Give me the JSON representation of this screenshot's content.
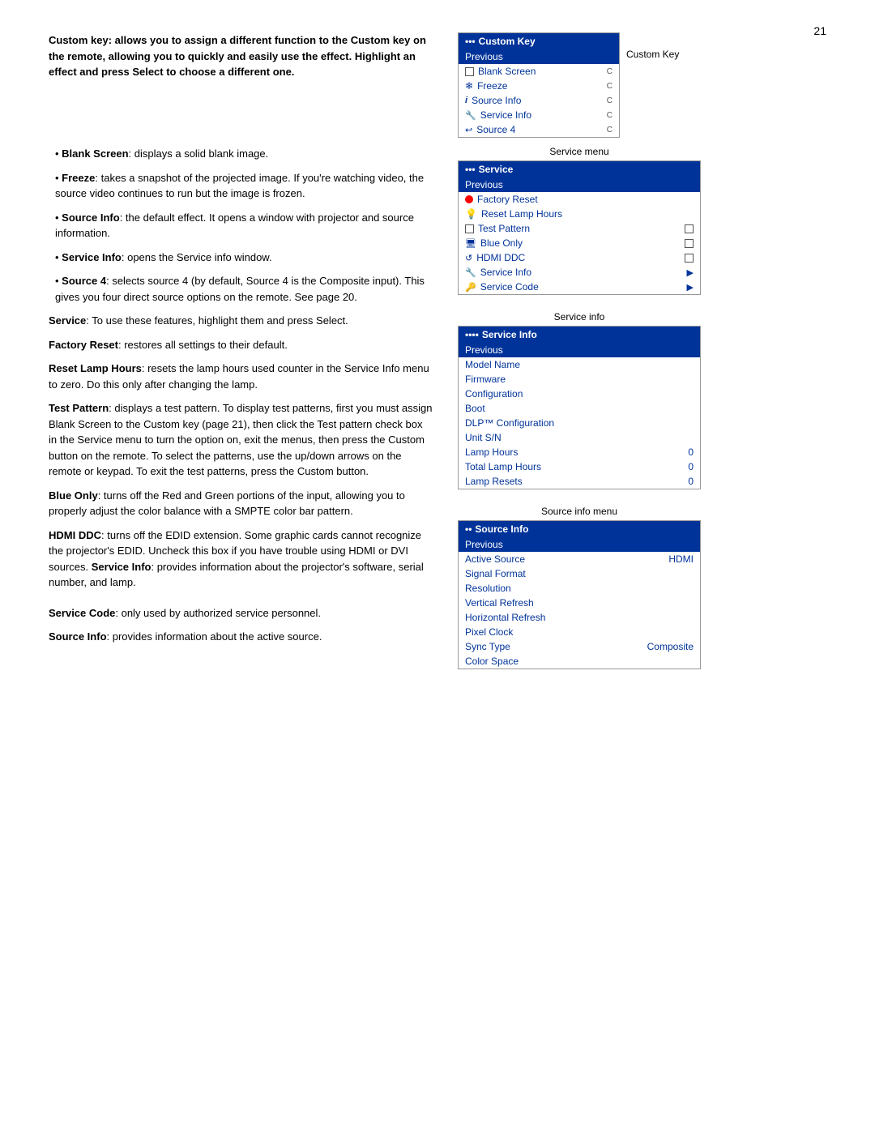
{
  "page": {
    "number": "21"
  },
  "left_content": {
    "intro": "Custom key: allows you to assign a different function to the Custom key on the remote, allowing you to quickly and easily use the effect. Highlight an effect and press Select to choose a different one.",
    "blank_screen_label": "Blank Screen",
    "blank_screen_text": ": displays a solid blank image.",
    "freeze_label": "Freeze",
    "freeze_text": ": takes a snapshot of the projected image. If you're watching video, the source video continues to run but the image is frozen.",
    "source_info_label": "Source Info",
    "source_info_text": ": the default effect. It opens a window with projector and source information.",
    "service_info_label": "Service Info",
    "service_info_text": ": opens the Service info window.",
    "source4_label": "Source 4",
    "source4_text": ": selects source 4 (by default, Source 4 is the Composite input). This gives you four direct source options on the remote. See page 20.",
    "service_intro_label": "Service",
    "service_intro_text": ": To use these features, highlight them and press Select.",
    "factory_reset_label": "Factory Reset",
    "factory_reset_text": ": restores all settings to their default.",
    "reset_lamp_label": "Reset Lamp Hours",
    "reset_lamp_text": ": resets the lamp hours used counter in the Service Info menu to zero. Do this only after changing the lamp.",
    "test_pattern_label": "Test Pattern",
    "test_pattern_text": ": displays a test pattern. To display test patterns, first you must assign Blank Screen to the Custom key (page 21), then click the Test pattern check box in the Service menu to turn the option on, exit the menus, then press the Custom button on the remote. To select the patterns, use the up/down arrows on the remote or keypad. To exit the test patterns, press the Custom button.",
    "blue_only_label": "Blue Only",
    "blue_only_text": ": turns off the Red and Green portions of the input, allowing you to properly adjust the color balance with a SMPTE color bar pattern.",
    "hdmi_ddc_label": "HDMI DDC",
    "hdmi_ddc_text": ": turns off the EDID extension. Some graphic cards cannot recognize the projector's EDID. Uncheck this box if you have trouble using HDMI or DVI sources.",
    "service_info2_label": "Service Info",
    "service_info2_text": ": provides information about the projector's software, serial number, and lamp.",
    "service_code_label": "Service Code",
    "service_code_text": ": only used by authorized service personnel.",
    "source_info2_label": "Source Info",
    "source_info2_text": ": provides information about the active source."
  },
  "custom_key_menu": {
    "title_dots": "•••",
    "title": "Custom Key",
    "previous": "Previous",
    "items": [
      {
        "icon": "checkbox",
        "label": "Blank Screen",
        "radio": "C"
      },
      {
        "icon": "freeze",
        "label": "Freeze",
        "radio": "C"
      },
      {
        "icon": "info",
        "label": "Source Info",
        "radio": "C"
      },
      {
        "icon": "wrench",
        "label": "Service Info",
        "radio": "C"
      },
      {
        "icon": "source",
        "label": "Source 4",
        "radio": "C"
      }
    ],
    "caption": "Custom Key"
  },
  "service_menu": {
    "section_label": "Service menu",
    "title_dots": "•••",
    "title": "Service",
    "previous": "Previous",
    "items": [
      {
        "icon": "red-dot",
        "label": "Factory Reset",
        "value": ""
      },
      {
        "icon": "gear",
        "label": "Reset Lamp Hours",
        "value": ""
      },
      {
        "icon": "checkbox",
        "label": "Test Pattern",
        "value": "checkbox"
      },
      {
        "icon": "monitor",
        "label": "Blue Only",
        "value": "checkbox"
      },
      {
        "icon": "hdmi",
        "label": "HDMI DDC",
        "value": "checkbox"
      },
      {
        "icon": "wrench",
        "label": "Service Info",
        "value": "arrow"
      },
      {
        "icon": "key",
        "label": "Service Code",
        "value": "arrow"
      }
    ]
  },
  "service_info_menu": {
    "section_label": "Service info",
    "title_dots": "••••",
    "title": "Service Info",
    "previous": "Previous",
    "items": [
      {
        "label": "Model Name",
        "value": ""
      },
      {
        "label": "Firmware",
        "value": ""
      },
      {
        "label": "Configuration",
        "value": ""
      },
      {
        "label": "Boot",
        "value": ""
      },
      {
        "label": "DLP™ Configuration",
        "value": ""
      },
      {
        "label": "Unit S/N",
        "value": ""
      },
      {
        "label": "Lamp Hours",
        "value": "0"
      },
      {
        "label": "Total Lamp Hours",
        "value": "0"
      },
      {
        "label": "Lamp Resets",
        "value": "0"
      }
    ]
  },
  "source_info_menu": {
    "section_label": "Source info menu",
    "title_dots": "••",
    "title": "Source Info",
    "previous": "Previous",
    "items": [
      {
        "label": "Active Source",
        "value": "HDMI"
      },
      {
        "label": "Signal Format",
        "value": ""
      },
      {
        "label": "Resolution",
        "value": ""
      },
      {
        "label": "Vertical Refresh",
        "value": ""
      },
      {
        "label": "Horizontal Refresh",
        "value": ""
      },
      {
        "label": "Pixel Clock",
        "value": ""
      },
      {
        "label": "Sync Type",
        "value": "Composite"
      },
      {
        "label": "Color Space",
        "value": ""
      }
    ]
  }
}
